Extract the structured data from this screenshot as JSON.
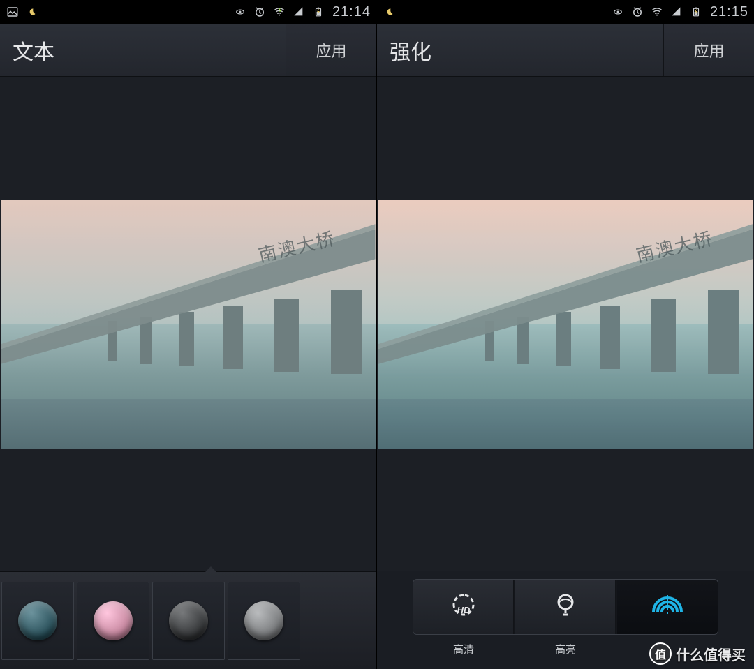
{
  "left": {
    "statusbar": {
      "time": "21:14"
    },
    "header": {
      "title": "文本",
      "apply": "应用"
    },
    "photo": {
      "caption": "南澳大桥"
    },
    "swatches": [
      {
        "name": "color-gold",
        "color": "#8a7236"
      },
      {
        "name": "color-teal",
        "color": "#2f5660"
      },
      {
        "name": "color-pink",
        "color": "#c98aa2"
      },
      {
        "name": "color-dark",
        "color": "#3a3c3e"
      },
      {
        "name": "color-gray",
        "color": "#7d7f81"
      }
    ]
  },
  "right": {
    "statusbar": {
      "time": "21:15"
    },
    "header": {
      "title": "强化",
      "apply": "应用"
    },
    "photo": {
      "caption": "南澳大桥"
    },
    "tools": [
      {
        "name": "hd",
        "label": "高清",
        "active": false
      },
      {
        "name": "highlight",
        "label": "高亮",
        "active": false
      },
      {
        "name": "defog",
        "label": "",
        "active": true
      }
    ]
  },
  "watermark": {
    "badge": "值",
    "text": "什么值得买"
  }
}
